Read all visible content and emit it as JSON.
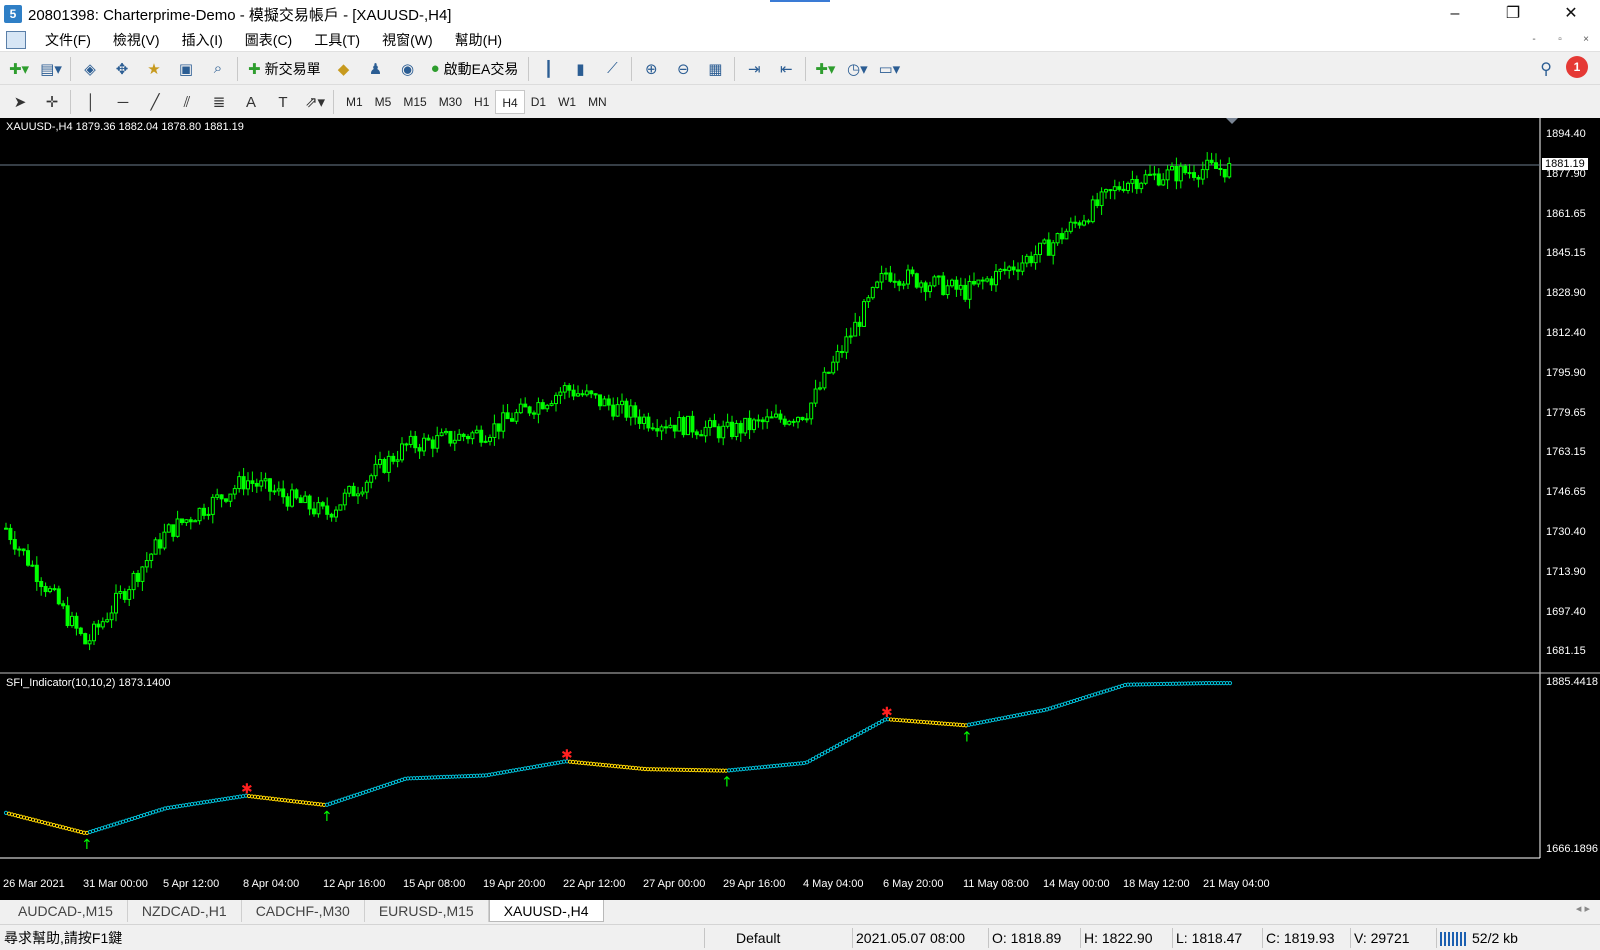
{
  "window": {
    "title": "20801398: Charterprime-Demo - 模擬交易帳戶 - [XAUUSD-,H4]",
    "minimize": "–",
    "restore": "❐",
    "close": "✕"
  },
  "menu": [
    "文件(F)",
    "檢視(V)",
    "插入(I)",
    "圖表(C)",
    "工具(T)",
    "視窗(W)",
    "幫助(H)"
  ],
  "toolbar": {
    "new_order": "新交易單",
    "autotrading": "啟動EA交易",
    "timeframes": [
      "M1",
      "M5",
      "M15",
      "M30",
      "H1",
      "H4",
      "D1",
      "W1",
      "MN"
    ],
    "active_timeframe": "H4",
    "notification_count": "1"
  },
  "chart": {
    "header": "XAUUSD-,H4  1879.36 1882.04 1878.80 1881.19",
    "current_price": "1881.19",
    "price_axis": [
      "1894.40",
      "1877.90",
      "1861.65",
      "1845.15",
      "1828.90",
      "1812.40",
      "1795.90",
      "1779.65",
      "1763.15",
      "1746.65",
      "1730.40",
      "1713.90",
      "1697.40",
      "1681.15"
    ],
    "indicator_header": "SFI_Indicator(10,10,2) 1873.1400",
    "indicator_axis_top": "1885.4418",
    "indicator_axis_bottom": "1666.1896",
    "dates": [
      "26 Mar 2021",
      "31 Mar 00:00",
      "5 Apr 12:00",
      "8 Apr 04:00",
      "12 Apr 16:00",
      "15 Apr 08:00",
      "19 Apr 20:00",
      "22 Apr 12:00",
      "27 Apr 00:00",
      "29 Apr 16:00",
      "4 May 04:00",
      "6 May 20:00",
      "11 May 08:00",
      "14 May 00:00",
      "18 May 12:00",
      "21 May 04:00"
    ],
    "colors": {
      "bull": "#00ff00",
      "bear": "#00ff00",
      "indicator_up": "#00bcd4",
      "indicator_down": "#ffd700",
      "arrow_up": "#00ff00",
      "arrow_down": "#ff2020"
    }
  },
  "chart_data": {
    "type": "line",
    "title": "XAUUSD-,H4",
    "x": [
      "26 Mar 2021",
      "31 Mar 00:00",
      "5 Apr 12:00",
      "8 Apr 04:00",
      "12 Apr 16:00",
      "15 Apr 08:00",
      "19 Apr 20:00",
      "22 Apr 12:00",
      "27 Apr 00:00",
      "29 Apr 16:00",
      "4 May 04:00",
      "6 May 20:00",
      "11 May 08:00",
      "14 May 00:00",
      "18 May 12:00",
      "21 May 04:00"
    ],
    "series": [
      {
        "name": "XAUUSD-,H4",
        "values": [
          1732,
          1684,
          1730,
          1752,
          1738,
          1766,
          1772,
          1790,
          1777,
          1772,
          1780,
          1838,
          1830,
          1848,
          1876,
          1881
        ]
      },
      {
        "name": "SFI_Indicator(10,10,2)",
        "values": [
          1716,
          1690,
          1722,
          1738,
          1726,
          1760,
          1764,
          1782,
          1772,
          1770,
          1780,
          1836,
          1828,
          1848,
          1880,
          1882
        ]
      }
    ],
    "ylim": [
      1672,
      1902
    ]
  },
  "tabs": [
    "AUDCAD-,M15",
    "NZDCAD-,H1",
    "CADCHF-,M30",
    "EURUSD-,M15",
    "XAUUSD-,H4"
  ],
  "active_tab": "XAUUSD-,H4",
  "status": {
    "help": "尋求幫助,請按F1鍵",
    "profile": "Default",
    "datetime": "2021.05.07 08:00",
    "open": "O: 1818.89",
    "high": "H: 1822.90",
    "low": "L: 1818.47",
    "close": "C: 1819.93",
    "volume": "V: 29721",
    "connection": "52/2 kb"
  }
}
